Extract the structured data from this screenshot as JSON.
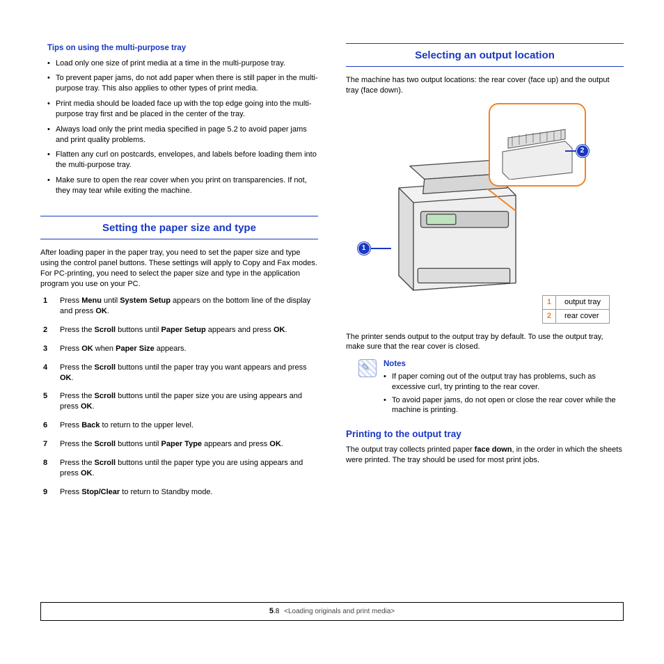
{
  "left": {
    "tips_heading": "Tips on using the multi-purpose tray",
    "tips": [
      "Load only one size of print media at a time in the multi-purpose tray.",
      "To prevent paper jams, do not add paper when there is still paper in the multi-purpose tray. This also applies to other types of print media.",
      "Print media should be loaded face up with the top edge going into the multi-purpose tray first and be placed in the center of the tray.",
      "Always load only the print media specified in page 5.2 to avoid paper jams and print quality problems.",
      "Flatten any curl on postcards, envelopes, and labels before loading them into the multi-purpose tray.",
      "Make sure to open the rear cover when you print on transparencies. If not, they may tear while exiting the machine."
    ],
    "section_heading": "Setting the paper size and type",
    "intro": "After loading paper in the paper tray, you need to set the paper size and type using the control panel buttons. These settings will apply to Copy and Fax modes. For PC-printing, you need to select the paper size and type in the application program you use on your PC.",
    "steps": [
      {
        "pre": "Press ",
        "b1": "Menu",
        "mid": " until ",
        "b2": "System Setup",
        "post": " appears on the bottom line of the display and press ",
        "b3": "OK",
        "tail": "."
      },
      {
        "pre": "Press the ",
        "b1": "Scroll",
        "mid": " buttons until ",
        "b2": "Paper Setup",
        "post": " appears and press ",
        "b3": "OK",
        "tail": "."
      },
      {
        "pre": "Press ",
        "b1": "OK",
        "mid": " when ",
        "b2": "Paper Size",
        "post": " appears.",
        "b3": "",
        "tail": ""
      },
      {
        "pre": "Press the ",
        "b1": "Scroll",
        "mid": " buttons until the paper tray you want appears and press ",
        "b2": "OK",
        "post": ".",
        "b3": "",
        "tail": ""
      },
      {
        "pre": "Press the ",
        "b1": "Scroll",
        "mid": " buttons until the paper size you are using appears and press ",
        "b2": "OK",
        "post": ".",
        "b3": "",
        "tail": ""
      },
      {
        "pre": "Press ",
        "b1": "Back",
        "mid": " to return to the upper level.",
        "b2": "",
        "post": "",
        "b3": "",
        "tail": ""
      },
      {
        "pre": "Press the ",
        "b1": "Scroll",
        "mid": " buttons until ",
        "b2": "Paper Type",
        "post": " appears and press ",
        "b3": "OK",
        "tail": "."
      },
      {
        "pre": "Press the ",
        "b1": "Scroll",
        "mid": " buttons until the paper type you are using appears and press ",
        "b2": "OK",
        "post": ".",
        "b3": "",
        "tail": ""
      },
      {
        "pre": "Press ",
        "b1": "Stop/Clear",
        "mid": " to return to Standby mode.",
        "b2": "",
        "post": "",
        "b3": "",
        "tail": ""
      }
    ]
  },
  "right": {
    "section_heading": "Selecting an output location",
    "intro": "The machine has two output locations: the rear cover (face up) and the output tray (face down).",
    "legend": {
      "1": "output tray",
      "2": "rear cover",
      "n1": "1",
      "n2": "2"
    },
    "after_diagram": "The printer sends output to the output tray by default. To use the output tray, make sure that the rear cover is closed.",
    "notes_heading": "Notes",
    "notes": [
      "If paper coming out of the output tray has problems, such as excessive curl, try printing to the rear cover.",
      "To avoid paper jams, do not open or close the rear cover while the machine is printing."
    ],
    "sub_heading": "Printing to the output tray",
    "out_pre": "The output tray collects printed paper ",
    "out_bold": "face down",
    "out_post": ", in the order in which the sheets were printed. The tray should be used for most print jobs."
  },
  "footer": {
    "chapter": "5",
    "page": ".8",
    "title": "<Loading originals and print media>"
  }
}
